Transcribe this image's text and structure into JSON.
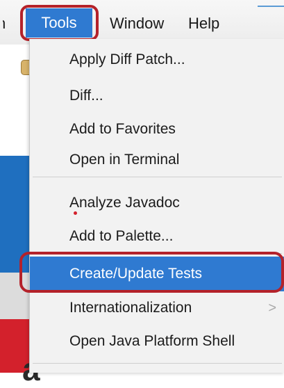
{
  "menubar": {
    "partial_label": "n",
    "tools_label": "Tools",
    "window_label": "Window",
    "help_label": "Help"
  },
  "tools_menu": {
    "group1": {
      "apply_diff_patch": "Apply Diff Patch...",
      "diff": "Diff...",
      "add_to_favorites": "Add to Favorites",
      "open_in_terminal": "Open in Terminal"
    },
    "group2": {
      "analyze_javadoc": "Analyze Javadoc",
      "add_to_palette": "Add to Palette..."
    },
    "group3": {
      "create_update_tests": "Create/Update Tests",
      "internationalization": "Internationalization",
      "open_java_platform_shell": "Open Java Platform Shell"
    },
    "submenu_arrow": ">"
  },
  "background": {
    "letter_1": "a"
  },
  "colors": {
    "selection_blue": "#2f7ad1",
    "highlight_red": "#b4222a",
    "menu_bg": "#f2f2f2"
  }
}
